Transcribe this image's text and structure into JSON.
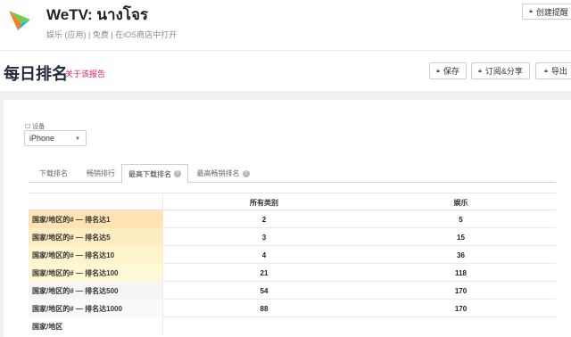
{
  "app": {
    "title": "WeTV: นางโจร",
    "meta": "娱乐 (应用) | 免费 | 在iOS商店中打开",
    "alert_button": "创建提醒"
  },
  "page": {
    "title": "每日排名",
    "report_link": "关于该报告",
    "save_button": "保存",
    "subscribe_button": "订阅&分享",
    "export_button": "导出"
  },
  "device": {
    "label": "设备",
    "selected": "iPhone"
  },
  "tabs": [
    {
      "label": "下载排名",
      "help": false
    },
    {
      "label": "畅销排行",
      "help": false
    },
    {
      "label": "最高下载排名",
      "help": true,
      "active": true
    },
    {
      "label": "最高畅销排名",
      "help": true
    }
  ],
  "table": {
    "columns": [
      "所有类别",
      "娱乐"
    ],
    "rows": [
      {
        "label": "国家/地区的# — 排名达1",
        "all": "2",
        "ent": "5",
        "color": "#ffe3b3"
      },
      {
        "label": "国家/地区的# — 排名达5",
        "all": "3",
        "ent": "15",
        "color": "#ffedc2"
      },
      {
        "label": "国家/地区的# — 排名达10",
        "all": "4",
        "ent": "36",
        "color": "#fff4cc"
      },
      {
        "label": "国家/地区的# — 排名达100",
        "all": "21",
        "ent": "118",
        "color": "#fff9d6"
      },
      {
        "label": "国家/地区的# — 排名达500",
        "all": "54",
        "ent": "170",
        "color": "#f5f5f5"
      },
      {
        "label": "国家/地区的# — 排名达1000",
        "all": "88",
        "ent": "170",
        "color": "#fafafa"
      }
    ],
    "country_header": "国家/地区"
  },
  "colors": {
    "accent_pink": "#e0245e",
    "logo_orange": "#ff7d1e",
    "logo_blue": "#1db4f5"
  }
}
